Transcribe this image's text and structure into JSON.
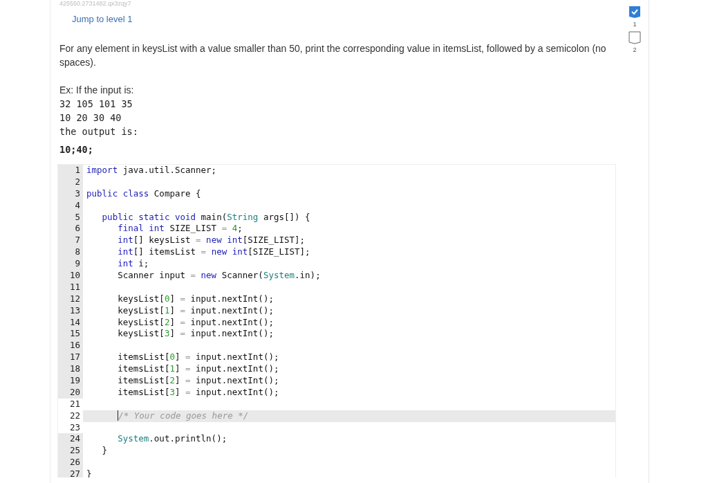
{
  "problem_id": "425550.2731482.qx3zqy7",
  "jump_link": "Jump to level 1",
  "levels": [
    {
      "label": "1",
      "checked": true
    },
    {
      "label": "2",
      "checked": false
    }
  ],
  "prompt": "For any element in keysList with a value smaller than 50, print the corresponding value in itemsList, followed by a semicolon (no spaces).",
  "example": {
    "intro": "Ex: If the input is:",
    "input_lines": [
      "32 105 101 35",
      "10 20 30 40"
    ],
    "output_intro": "the output is:",
    "output": "10;40;"
  },
  "editor": {
    "lines": [
      {
        "number": "1",
        "tokens": [
          {
            "kind": "keyword",
            "text": "import"
          },
          {
            "kind": "plain",
            "text": " java.util.Scanner;"
          }
        ]
      },
      {
        "number": "2"
      },
      {
        "number": "3",
        "tokens": [
          {
            "kind": "keyword",
            "text": "public class"
          },
          {
            "kind": "plain",
            "text": " Compare {"
          }
        ]
      },
      {
        "number": "4"
      },
      {
        "number": "5",
        "tokens": [
          {
            "kind": "keyword",
            "text": "   public static void"
          },
          {
            "kind": "plain",
            "text": " main("
          },
          {
            "kind": "type",
            "text": "String"
          },
          {
            "kind": "plain",
            "text": " args[]) {"
          }
        ]
      },
      {
        "number": "6",
        "tokens": [
          {
            "kind": "keyword",
            "text": "      final int"
          },
          {
            "kind": "plain",
            "text": " SIZE_LIST "
          },
          {
            "kind": "operator",
            "text": "="
          },
          {
            "kind": "number",
            "text": " 4"
          },
          {
            "kind": "plain",
            "text": ";"
          }
        ]
      },
      {
        "number": "7",
        "tokens": [
          {
            "kind": "keyword",
            "text": "      int"
          },
          {
            "kind": "plain",
            "text": "[] keysList "
          },
          {
            "kind": "operator",
            "text": "="
          },
          {
            "kind": "keyword",
            "text": " new int"
          },
          {
            "kind": "plain",
            "text": "[SIZE_LIST];"
          }
        ]
      },
      {
        "number": "8",
        "tokens": [
          {
            "kind": "keyword",
            "text": "      int"
          },
          {
            "kind": "plain",
            "text": "[] itemsList "
          },
          {
            "kind": "operator",
            "text": "="
          },
          {
            "kind": "keyword",
            "text": " new int"
          },
          {
            "kind": "plain",
            "text": "[SIZE_LIST];"
          }
        ]
      },
      {
        "number": "9",
        "tokens": [
          {
            "kind": "keyword",
            "text": "      int"
          },
          {
            "kind": "plain",
            "text": " i;"
          }
        ]
      },
      {
        "number": "10",
        "tokens": [
          {
            "kind": "plain",
            "text": "      Scanner input "
          },
          {
            "kind": "operator",
            "text": "="
          },
          {
            "kind": "keyword",
            "text": " new"
          },
          {
            "kind": "plain",
            "text": " Scanner("
          },
          {
            "kind": "type",
            "text": "System"
          },
          {
            "kind": "plain",
            "text": ".in);"
          }
        ]
      },
      {
        "number": "11"
      },
      {
        "number": "12",
        "tokens": [
          {
            "kind": "plain",
            "text": "      keysList["
          },
          {
            "kind": "number",
            "text": "0"
          },
          {
            "kind": "plain",
            "text": "] "
          },
          {
            "kind": "operator",
            "text": "="
          },
          {
            "kind": "plain",
            "text": " input.nextInt();"
          }
        ]
      },
      {
        "number": "13",
        "tokens": [
          {
            "kind": "plain",
            "text": "      keysList["
          },
          {
            "kind": "number",
            "text": "1"
          },
          {
            "kind": "plain",
            "text": "] "
          },
          {
            "kind": "operator",
            "text": "="
          },
          {
            "kind": "plain",
            "text": " input.nextInt();"
          }
        ]
      },
      {
        "number": "14",
        "tokens": [
          {
            "kind": "plain",
            "text": "      keysList["
          },
          {
            "kind": "number",
            "text": "2"
          },
          {
            "kind": "plain",
            "text": "] "
          },
          {
            "kind": "operator",
            "text": "="
          },
          {
            "kind": "plain",
            "text": " input.nextInt();"
          }
        ]
      },
      {
        "number": "15",
        "tokens": [
          {
            "kind": "plain",
            "text": "      keysList["
          },
          {
            "kind": "number",
            "text": "3"
          },
          {
            "kind": "plain",
            "text": "] "
          },
          {
            "kind": "operator",
            "text": "="
          },
          {
            "kind": "plain",
            "text": " input.nextInt();"
          }
        ]
      },
      {
        "number": "16"
      },
      {
        "number": "17",
        "tokens": [
          {
            "kind": "plain",
            "text": "      itemsList["
          },
          {
            "kind": "number",
            "text": "0"
          },
          {
            "kind": "plain",
            "text": "] "
          },
          {
            "kind": "operator",
            "text": "="
          },
          {
            "kind": "plain",
            "text": " input.nextInt();"
          }
        ]
      },
      {
        "number": "18",
        "tokens": [
          {
            "kind": "plain",
            "text": "      itemsList["
          },
          {
            "kind": "number",
            "text": "1"
          },
          {
            "kind": "plain",
            "text": "] "
          },
          {
            "kind": "operator",
            "text": "="
          },
          {
            "kind": "plain",
            "text": " input.nextInt();"
          }
        ]
      },
      {
        "number": "19",
        "tokens": [
          {
            "kind": "plain",
            "text": "      itemsList["
          },
          {
            "kind": "number",
            "text": "2"
          },
          {
            "kind": "plain",
            "text": "] "
          },
          {
            "kind": "operator",
            "text": "="
          },
          {
            "kind": "plain",
            "text": " input.nextInt();"
          }
        ]
      },
      {
        "number": "20",
        "tokens": [
          {
            "kind": "plain",
            "text": "      itemsList["
          },
          {
            "kind": "number",
            "text": "3"
          },
          {
            "kind": "plain",
            "text": "] "
          },
          {
            "kind": "operator",
            "text": "="
          },
          {
            "kind": "plain",
            "text": " input.nextInt();"
          }
        ]
      },
      {
        "number": "21",
        "editable": true
      },
      {
        "number": "22",
        "editable": true,
        "active": true,
        "tokens": [
          {
            "kind": "comment",
            "text": "      /* Your code goes here */"
          }
        ]
      },
      {
        "number": "23",
        "editable": true
      },
      {
        "number": "24",
        "tokens": [
          {
            "kind": "type",
            "text": "      System"
          },
          {
            "kind": "plain",
            "text": ".out.println();"
          }
        ]
      },
      {
        "number": "25",
        "tokens": [
          {
            "kind": "plain",
            "text": "   }"
          }
        ]
      },
      {
        "number": "26"
      },
      {
        "number": "27",
        "tokens": [
          {
            "kind": "plain",
            "text": "}"
          }
        ]
      }
    ]
  }
}
